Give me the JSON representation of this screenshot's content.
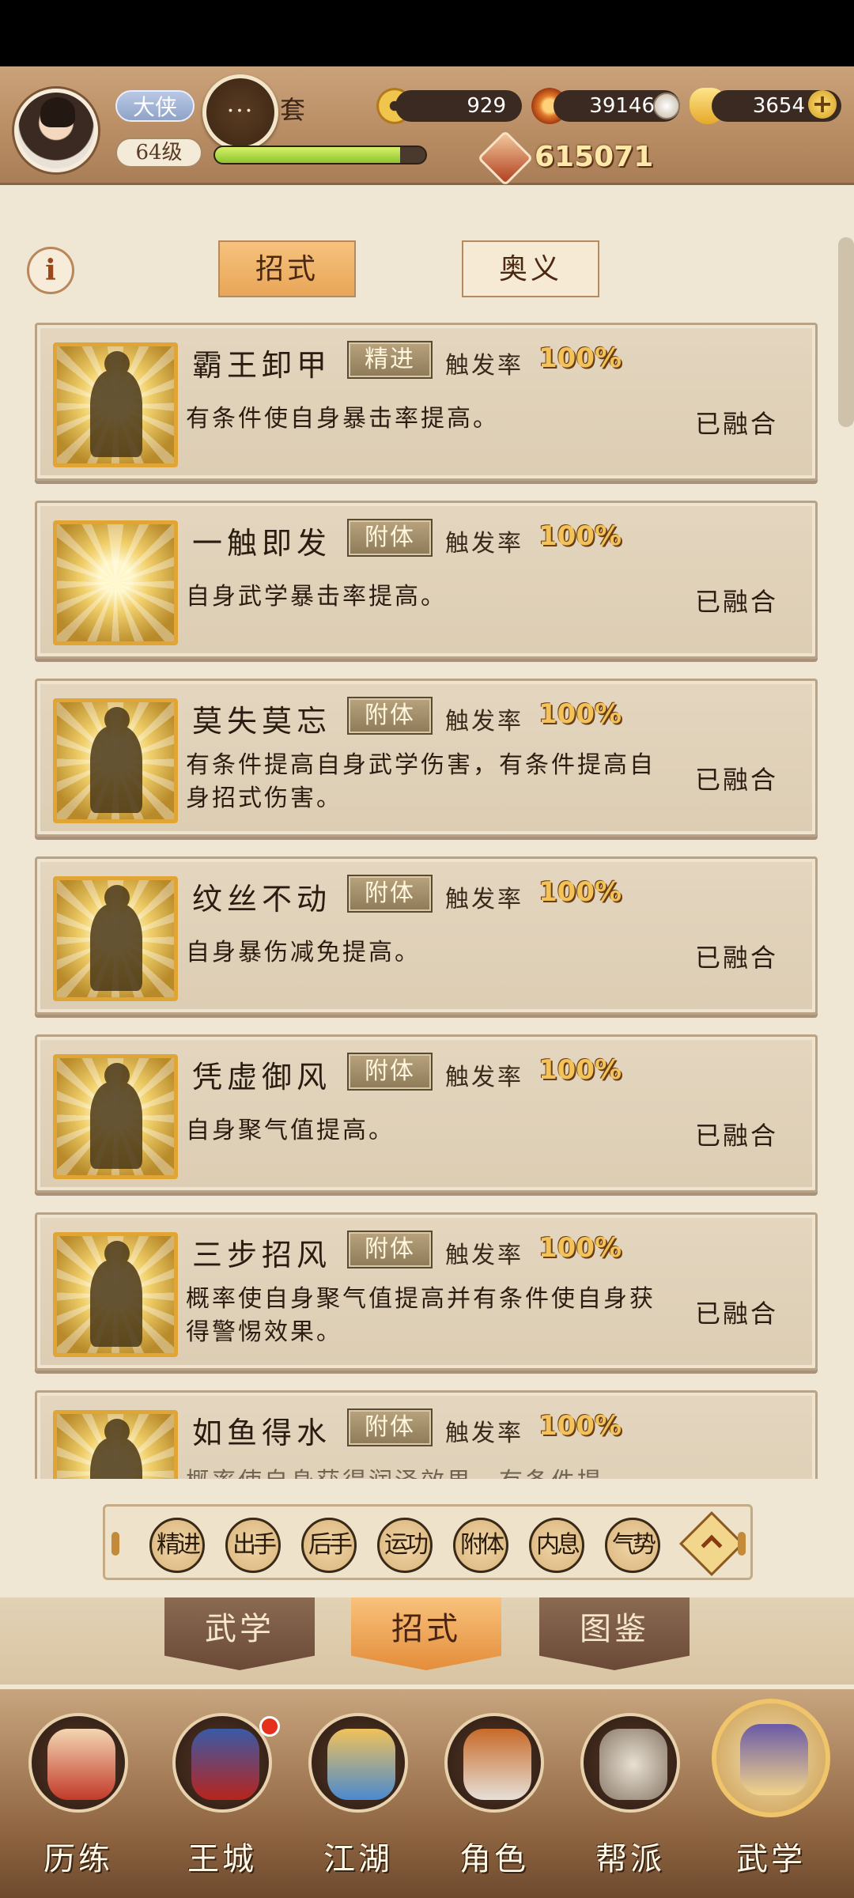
{
  "player": {
    "title": "大侠",
    "name_suffix": "套",
    "chat": "···",
    "level": "64级",
    "exp_fraction": 0.88,
    "power": "615071"
  },
  "resources": {
    "copper": "929",
    "flame": "39146",
    "gold": "3654",
    "add": "+"
  },
  "info_icon": "i",
  "subtabs": {
    "moves": "招式",
    "mystic": "奥义"
  },
  "skills": [
    {
      "name": "霸王卸甲",
      "tag": "精进",
      "rate_label": "触发率",
      "rate": "100%",
      "desc": "有条件使自身暴击率提高。",
      "status": "已融合"
    },
    {
      "name": "一触即发",
      "tag": "附体",
      "rate_label": "触发率",
      "rate": "100%",
      "desc": "自身武学暴击率提高。",
      "status": "已融合"
    },
    {
      "name": "莫失莫忘",
      "tag": "附体",
      "rate_label": "触发率",
      "rate": "100%",
      "desc": "有条件提高自身武学伤害，有条件提高自身招式伤害。",
      "status": "已融合"
    },
    {
      "name": "纹丝不动",
      "tag": "附体",
      "rate_label": "触发率",
      "rate": "100%",
      "desc": "自身暴伤减免提高。",
      "status": "已融合"
    },
    {
      "name": "凭虚御风",
      "tag": "附体",
      "rate_label": "触发率",
      "rate": "100%",
      "desc": "自身聚气值提高。",
      "status": "已融合"
    },
    {
      "name": "三步招风",
      "tag": "附体",
      "rate_label": "触发率",
      "rate": "100%",
      "desc": "概率使自身聚气值提高并有条件使自身获得警惕效果。",
      "status": "已融合"
    },
    {
      "name": "如鱼得水",
      "tag": "附体",
      "rate_label": "触发率",
      "rate": "100%",
      "desc": "概率使自身获得润泽效果，有条件提",
      "status": ""
    }
  ],
  "filters": [
    "精进",
    "出手",
    "后手",
    "运功",
    "附体",
    "内息",
    "气势"
  ],
  "bottom_tabs": [
    "武学",
    "招式",
    "图鉴"
  ],
  "nav": [
    "历练",
    "王城",
    "江湖",
    "角色",
    "帮派",
    "武学"
  ],
  "colors": {
    "accent": "#e8a658",
    "rate": "#f3c35a",
    "badge": "#e4301c"
  }
}
